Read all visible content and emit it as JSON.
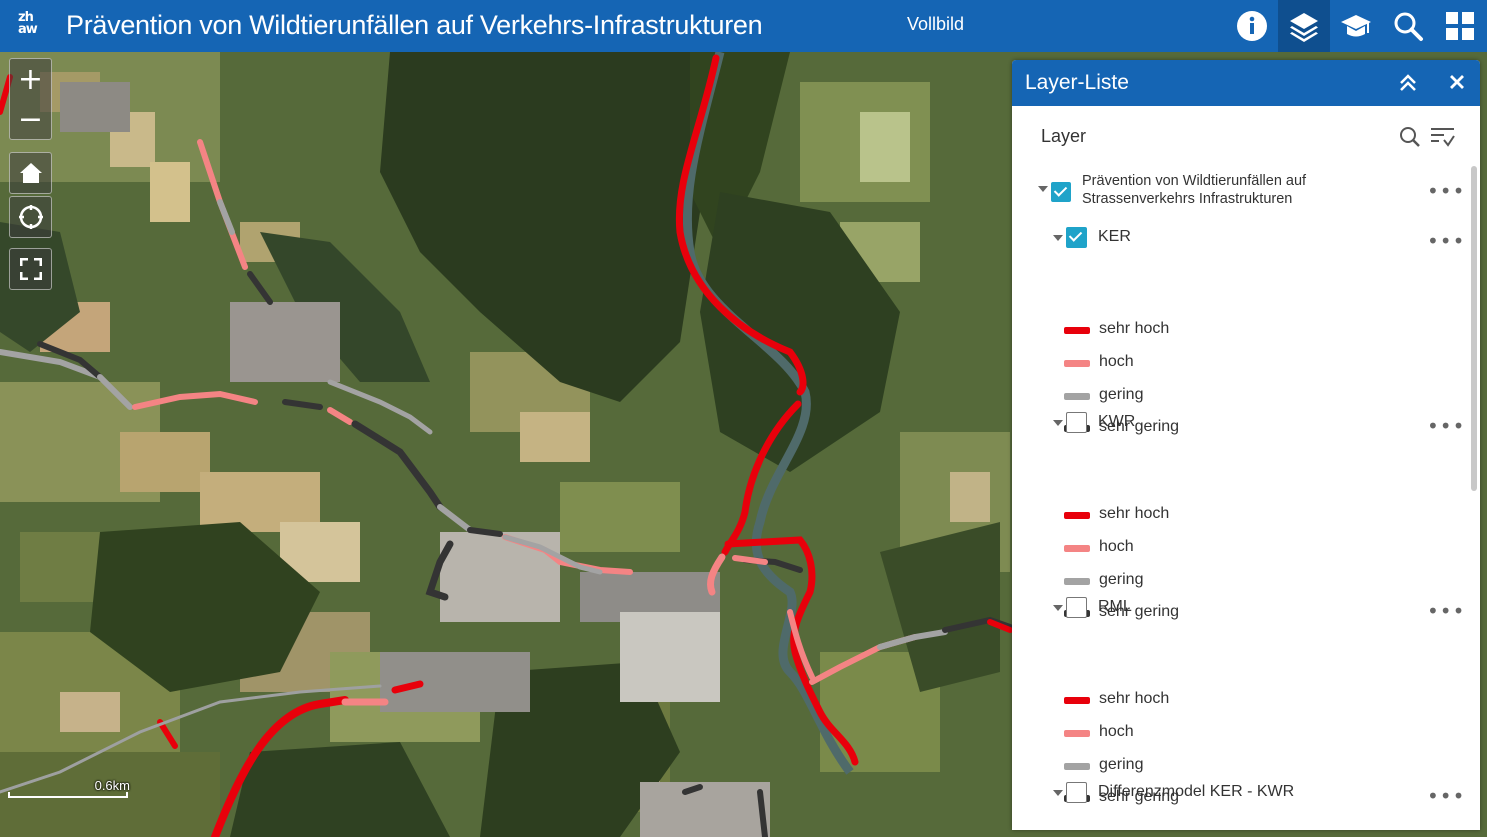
{
  "header": {
    "logo_line1": "zh",
    "logo_line2": "aw",
    "title": "Prävention von Wildtierunfällen auf Verkehrs-Infrastrukturen",
    "fullscreen_label": "Vollbild",
    "tools": [
      "info-icon",
      "layers-icon",
      "graduation-cap-icon",
      "search-icon",
      "grid-icon"
    ]
  },
  "map": {
    "zoom_in": "+",
    "zoom_out": "−",
    "scale_label": "0.6km"
  },
  "panel": {
    "title": "Layer-Liste",
    "section_heading": "Layer",
    "group": {
      "name": "Prävention von Wildtierunfällen auf Strassenverkehrs Infrastrukturen",
      "checked": true
    },
    "layers": [
      {
        "name": "KER",
        "checked": true,
        "legend": [
          {
            "label": "sehr hoch",
            "color": "#e8000b"
          },
          {
            "label": "hoch",
            "color": "#f48484"
          },
          {
            "label": "gering",
            "color": "#a3a3a3"
          },
          {
            "label": "sehr gering",
            "color": "#343434"
          }
        ]
      },
      {
        "name": "KWR",
        "checked": false,
        "legend": [
          {
            "label": "sehr hoch",
            "color": "#e8000b"
          },
          {
            "label": "hoch",
            "color": "#f48484"
          },
          {
            "label": "gering",
            "color": "#a3a3a3"
          },
          {
            "label": "sehr gering",
            "color": "#343434"
          }
        ]
      },
      {
        "name": "RML",
        "checked": false,
        "legend": [
          {
            "label": "sehr hoch",
            "color": "#e8000b"
          },
          {
            "label": "hoch",
            "color": "#f48484"
          },
          {
            "label": "gering",
            "color": "#a3a3a3"
          },
          {
            "label": "sehr gering",
            "color": "#343434"
          }
        ]
      },
      {
        "name": "Differenzmodel KER - KWR",
        "checked": false,
        "legend": []
      }
    ]
  },
  "colors": {
    "header_bg": "#1565b4",
    "checkbox_checked": "#1fa3c9",
    "road_very_high": "#e8000b",
    "road_high": "#f48484",
    "road_low": "#a3a3a3",
    "road_very_low": "#343434"
  }
}
